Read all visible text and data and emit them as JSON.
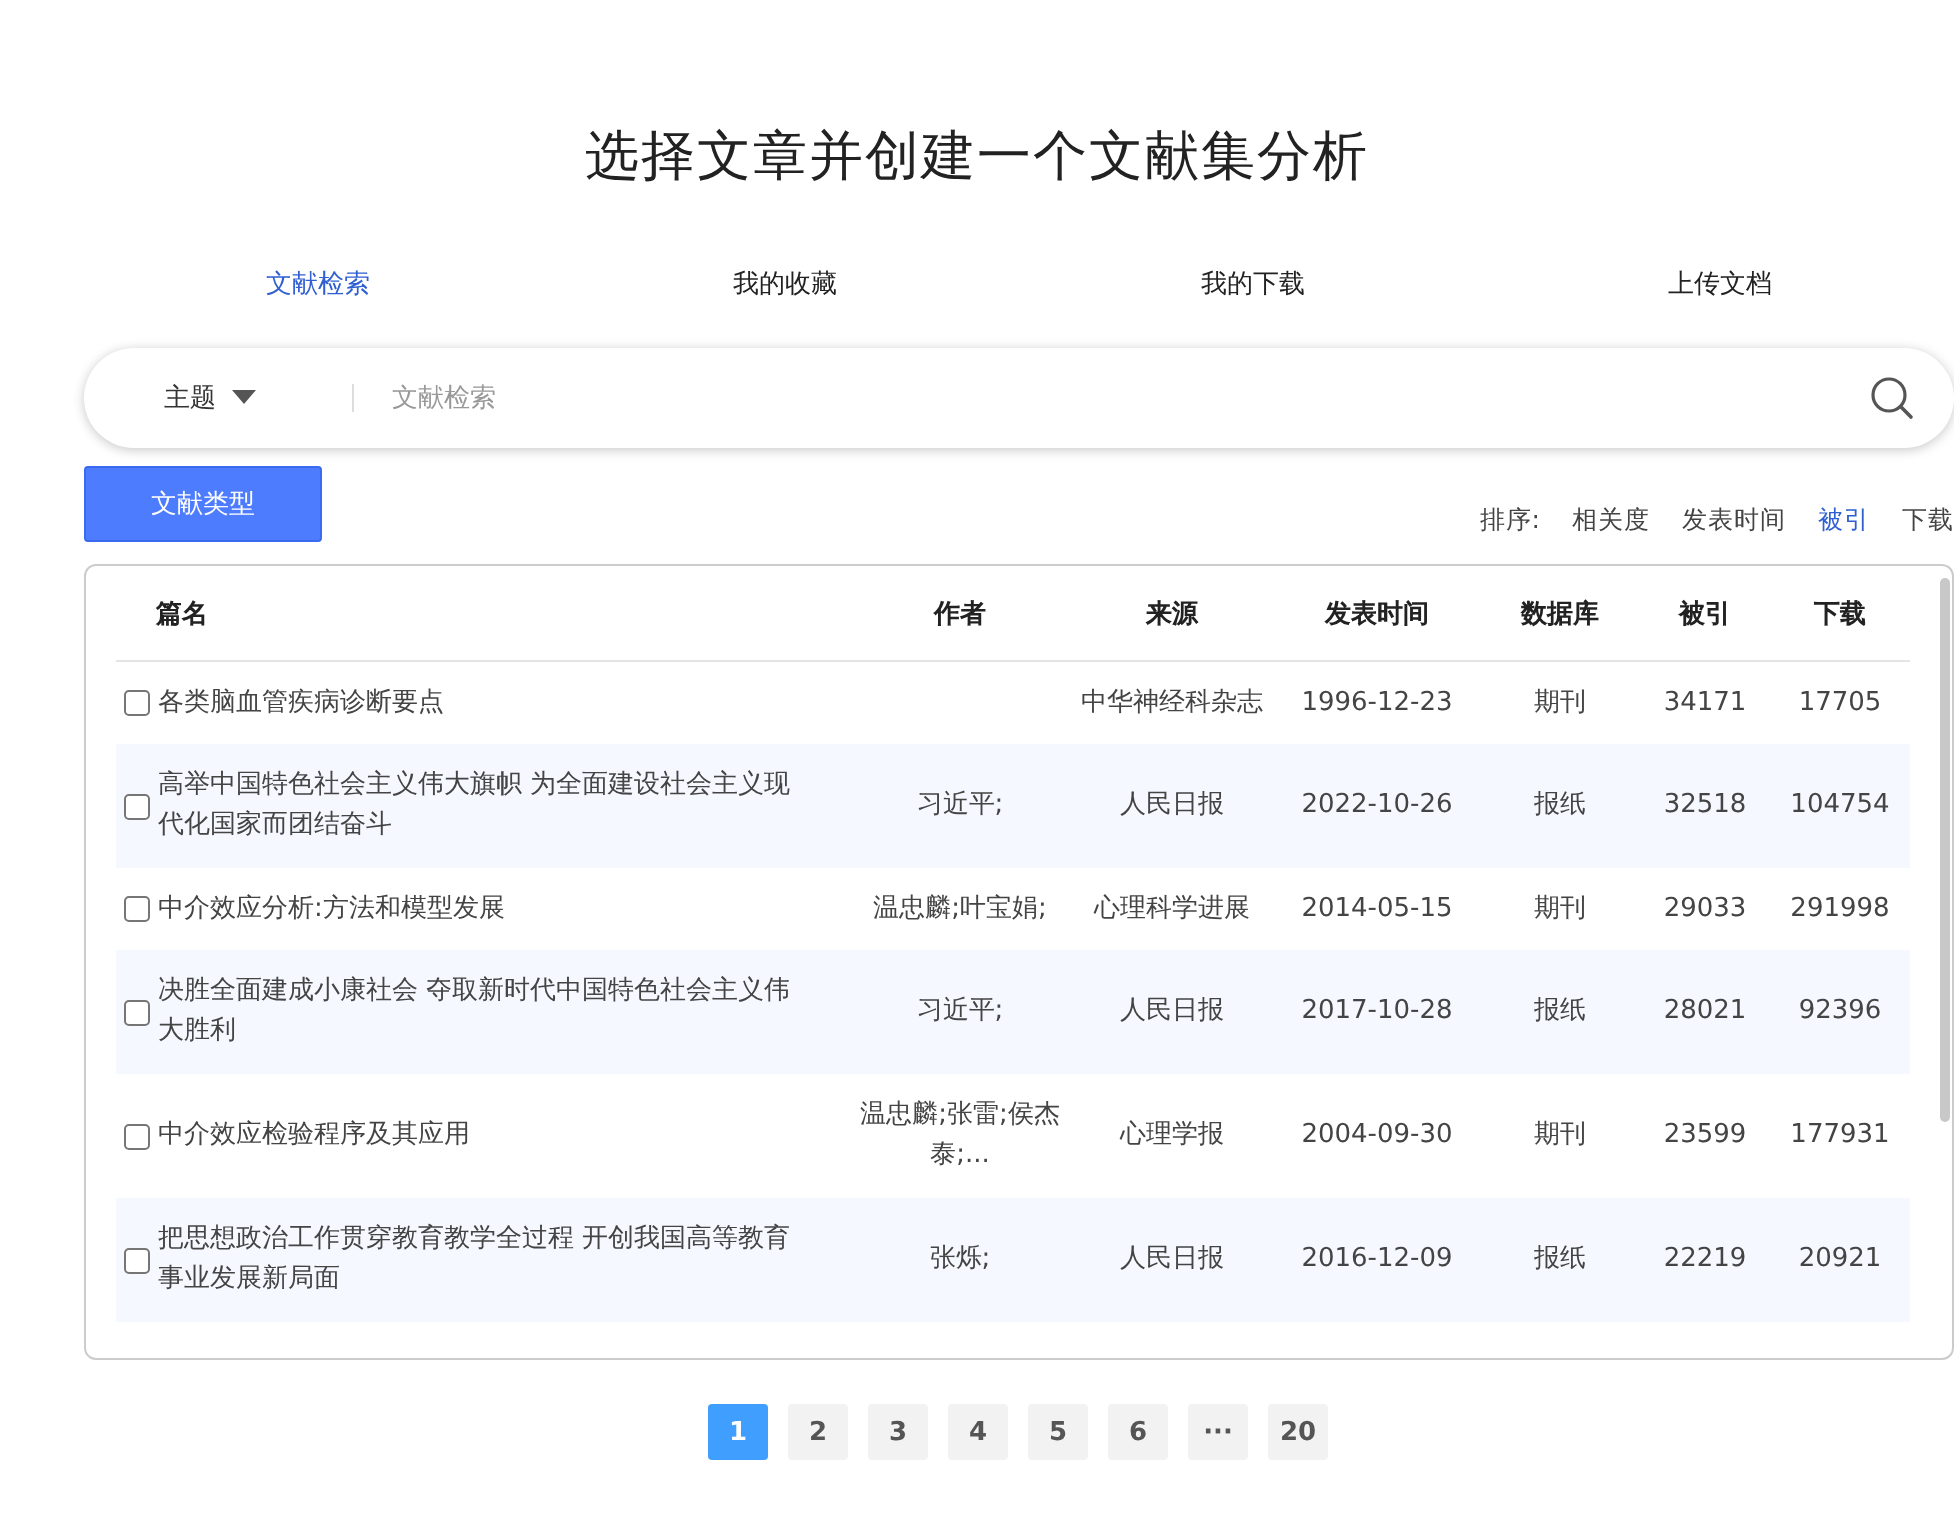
{
  "title": "选择文章并创建一个文献集分析",
  "tabs": [
    {
      "label": "文献检索",
      "selected": true
    },
    {
      "label": "我的收藏",
      "selected": false
    },
    {
      "label": "我的下载",
      "selected": false
    },
    {
      "label": "上传文档",
      "selected": false
    }
  ],
  "search": {
    "field_option": "主题",
    "placeholder": "文献检索"
  },
  "filter_button": "文献类型",
  "sort": {
    "label": "排序:",
    "options": [
      {
        "label": "相关度",
        "selected": false
      },
      {
        "label": "发表时间",
        "selected": false
      },
      {
        "label": "被引",
        "selected": true
      },
      {
        "label": "下载",
        "selected": false
      }
    ]
  },
  "table": {
    "columns": [
      "篇名",
      "作者",
      "来源",
      "发表时间",
      "数据库",
      "被引",
      "下载"
    ],
    "rows": [
      {
        "checked": false,
        "title": "各类脑血管疾病诊断要点",
        "source": "中华神经科杂志",
        "date": "1996-12-23",
        "database": "期刊",
        "citations": "34171",
        "downloads": "17705"
      },
      {
        "checked": false,
        "title": "高举中国特色社会主义伟大旗帜 为全面建设社会主义现代化国家而团结奋斗",
        "author": "习近平;",
        "source": "人民日报",
        "date": "2022-10-26",
        "database": "报纸",
        "citations": "32518",
        "downloads": "104754"
      },
      {
        "checked": false,
        "title": "中介效应分析:方法和模型发展",
        "author": "温忠麟;叶宝娟;",
        "source": "心理科学进展",
        "date": "2014-05-15",
        "database": "期刊",
        "citations": "29033",
        "downloads": "291998"
      },
      {
        "checked": false,
        "title": "决胜全面建成小康社会 夺取新时代中国特色社会主义伟大胜利",
        "author": "习近平;",
        "source": "人民日报",
        "date": "2017-10-28",
        "database": "报纸",
        "citations": "28021",
        "downloads": "92396"
      },
      {
        "checked": false,
        "title": "中介效应检验程序及其应用",
        "author": "温忠麟;张雷;侯杰泰;...",
        "source": "心理学报",
        "date": "2004-09-30",
        "database": "期刊",
        "citations": "23599",
        "downloads": "177931"
      },
      {
        "checked": false,
        "title": "把思想政治工作贯穿教育教学全过程 开创我国高等教育事业发展新局面",
        "author": "张烁;",
        "source": "人民日报",
        "date": "2016-12-09",
        "database": "报纸",
        "citations": "22219",
        "downloads": "20921"
      }
    ]
  },
  "pagination": [
    {
      "label": "1",
      "selected": true
    },
    {
      "label": "2",
      "selected": false
    },
    {
      "label": "3",
      "selected": false
    },
    {
      "label": "4",
      "selected": false
    },
    {
      "label": "5",
      "selected": false
    },
    {
      "label": "6",
      "selected": false
    },
    {
      "label": "···",
      "selected": false
    },
    {
      "label": "20",
      "selected": false
    }
  ]
}
